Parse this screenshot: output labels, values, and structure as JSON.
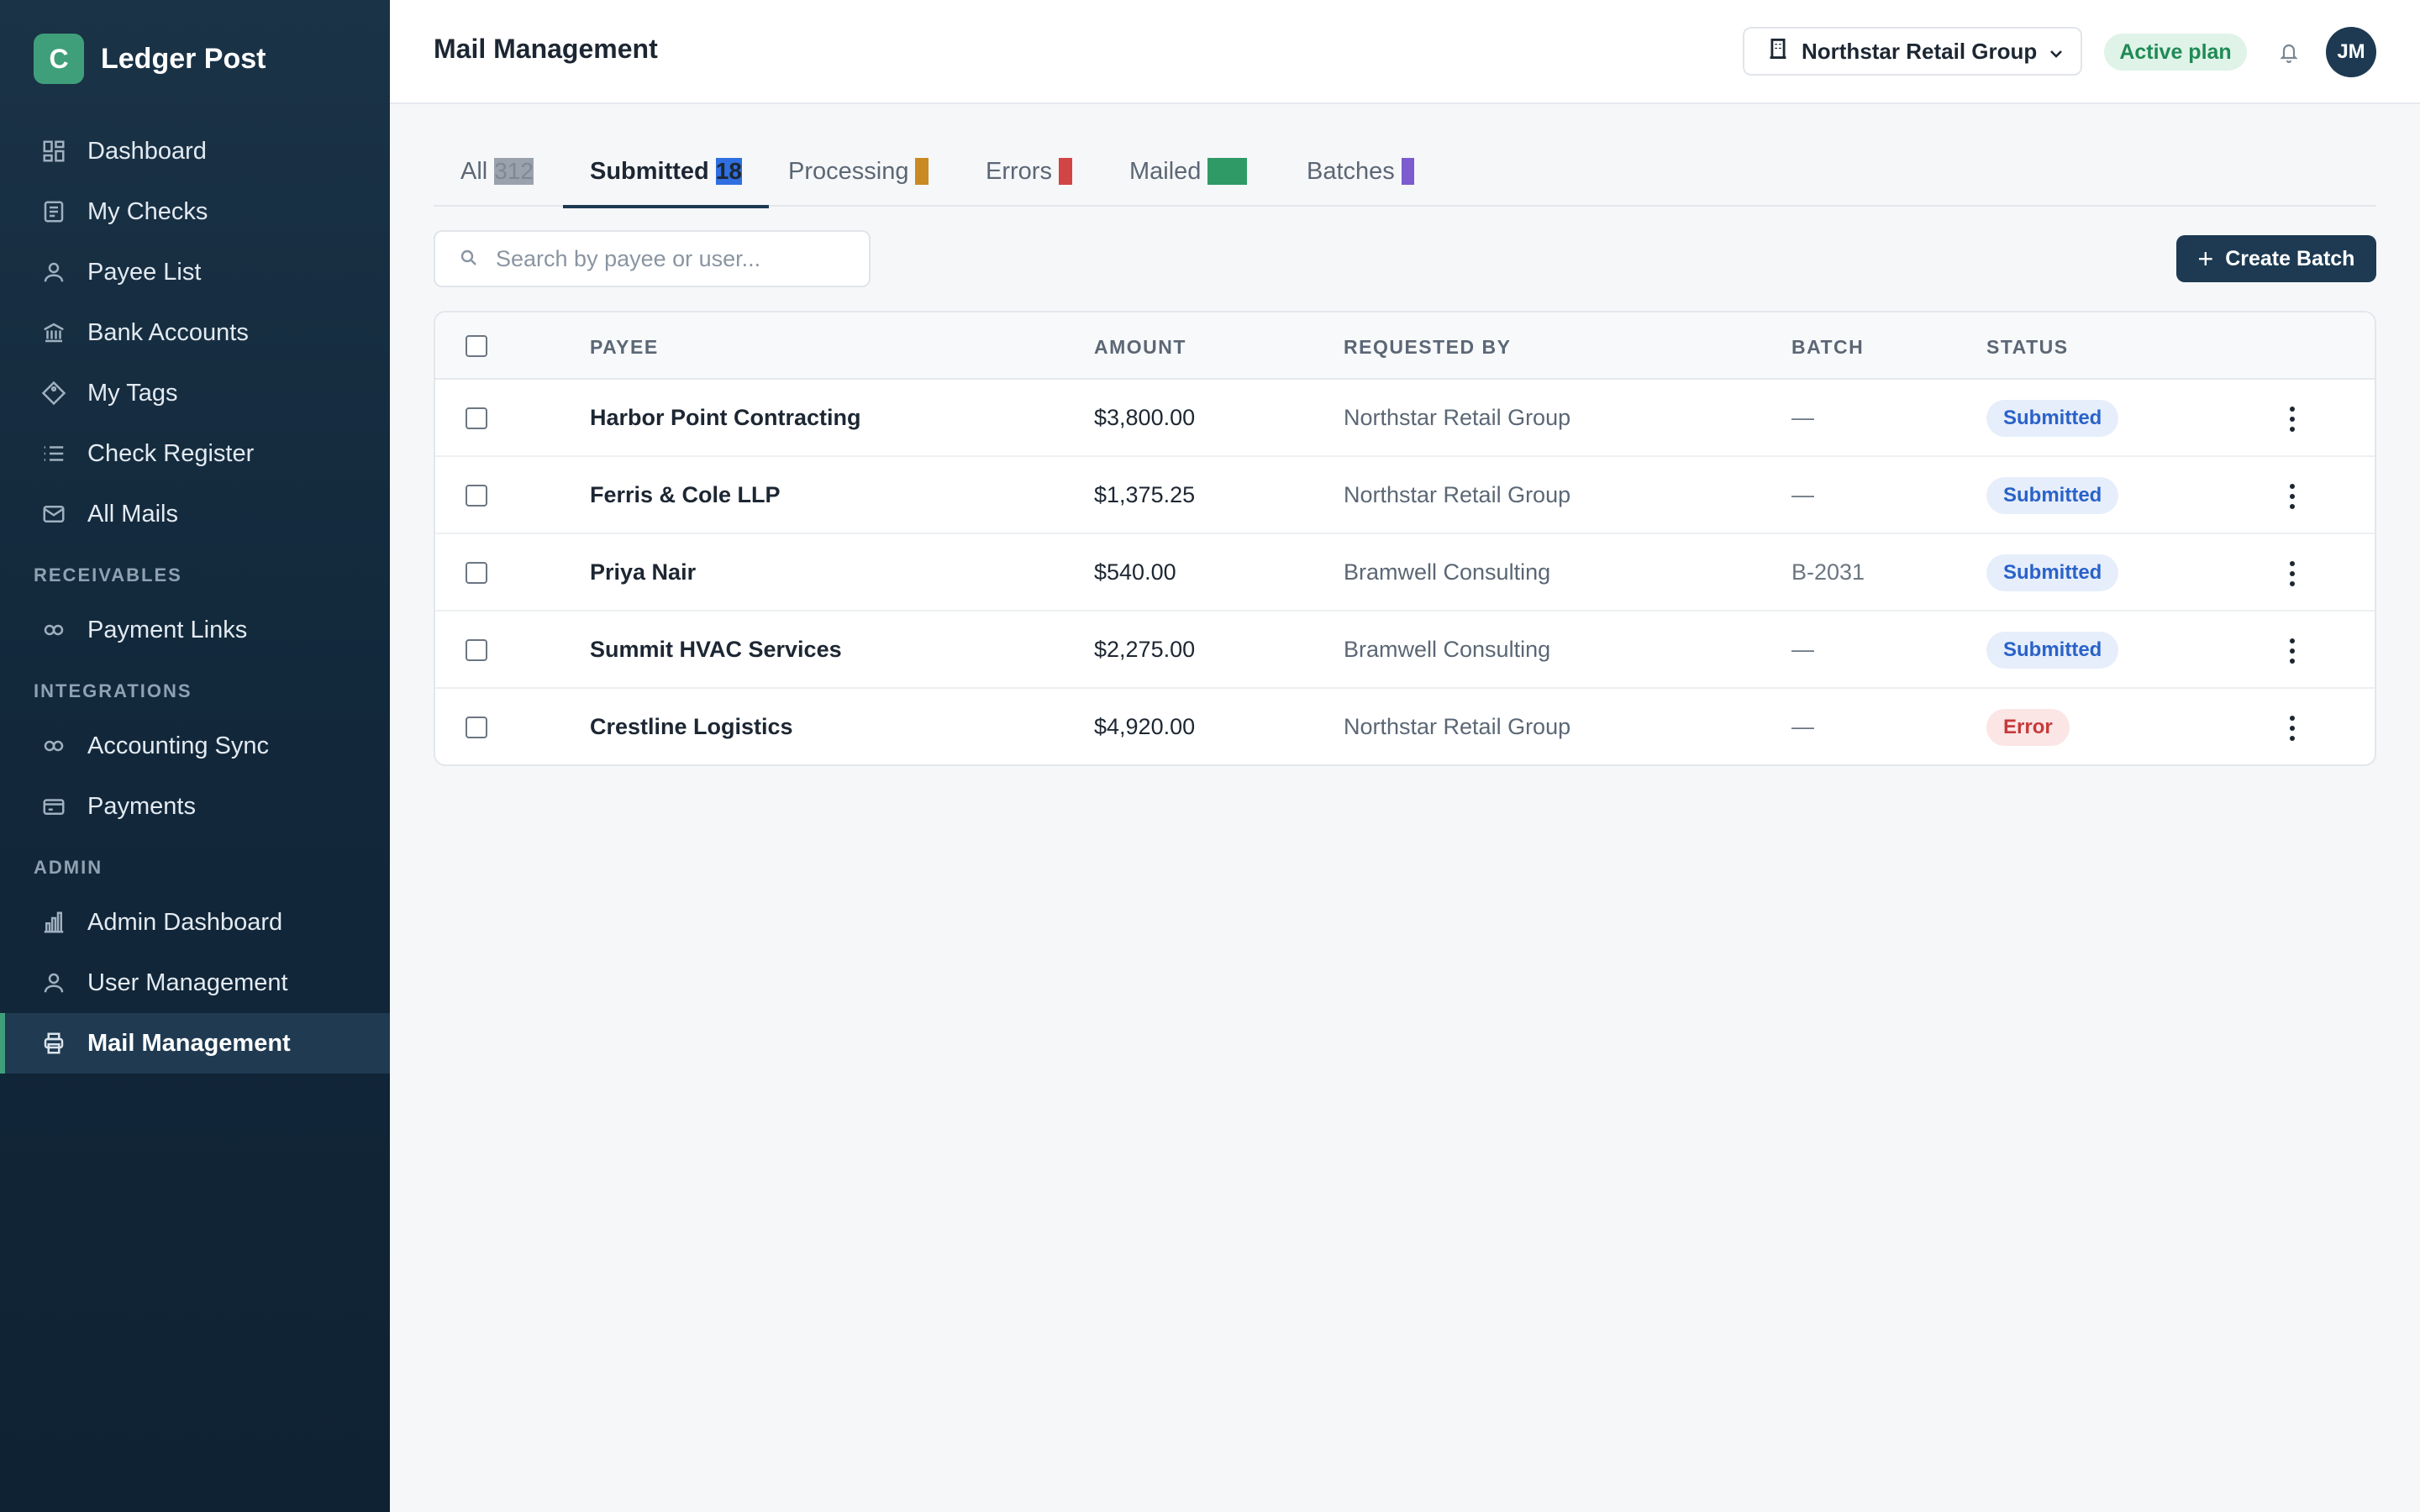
{
  "app": {
    "logo_letter": "C",
    "name": "Ledger Post"
  },
  "sidebar": {
    "items": [
      {
        "label": "Dashboard",
        "icon": "dashboard-icon"
      },
      {
        "label": "My Checks",
        "icon": "checks-icon"
      },
      {
        "label": "Payee List",
        "icon": "user-icon"
      },
      {
        "label": "Bank Accounts",
        "icon": "bank-icon"
      },
      {
        "label": "My Tags",
        "icon": "tag-icon"
      },
      {
        "label": "Check Register",
        "icon": "list-icon"
      },
      {
        "label": "All Mails",
        "icon": "mail-icon"
      }
    ],
    "sections": {
      "receivables": {
        "title": "RECEIVABLES",
        "items": [
          {
            "label": "Payment Links",
            "icon": "link-icon"
          }
        ]
      },
      "integrations": {
        "title": "INTEGRATIONS",
        "items": [
          {
            "label": "Accounting Sync",
            "icon": "link-icon"
          },
          {
            "label": "Payments",
            "icon": "card-icon"
          }
        ]
      },
      "admin": {
        "title": "ADMIN",
        "items": [
          {
            "label": "Admin Dashboard",
            "icon": "bar-chart-icon"
          },
          {
            "label": "User Management",
            "icon": "user-icon"
          },
          {
            "label": "Mail Management",
            "icon": "printer-icon",
            "active": true
          }
        ]
      }
    }
  },
  "header": {
    "title": "Mail Management",
    "org_selector": "Northstar Retail Group",
    "plan_badge": "Active plan",
    "avatar_initials": "JM"
  },
  "tabs": [
    {
      "label": "All",
      "count": "312",
      "count_bg": "#9aa3ad",
      "count_color": "#7f8893"
    },
    {
      "label": "Submitted",
      "count": "18",
      "count_bg": "#2f6fe0",
      "count_color": "#1d2733",
      "active": true
    },
    {
      "label": "Processing",
      "count": "4",
      "count_bg": "#c98a23",
      "count_color": "#c98a23"
    },
    {
      "label": "Errors",
      "count": "2",
      "count_bg": "#d24545",
      "count_color": "#d24545"
    },
    {
      "label": "Mailed",
      "count": "278",
      "count_bg": "#2f9a66",
      "count_color": "#2f9a66"
    },
    {
      "label": "Batches",
      "count": "9",
      "count_bg": "#7c5ccf",
      "count_color": "#7c5ccf"
    }
  ],
  "search": {
    "placeholder": "Search by payee or user..."
  },
  "toolbar": {
    "create_batch_label": "Create Batch"
  },
  "table": {
    "columns": {
      "payee": "PAYEE",
      "amount": "AMOUNT",
      "requested_by": "REQUESTED BY",
      "batch": "BATCH",
      "status": "STATUS"
    },
    "rows": [
      {
        "payee": "Harbor Point Contracting",
        "amount": "$3,800.00",
        "requested_by": "Northstar Retail Group",
        "batch": "—",
        "status": "Submitted",
        "status_type": "submitted"
      },
      {
        "payee": "Ferris & Cole LLP",
        "amount": "$1,375.25",
        "requested_by": "Northstar Retail Group",
        "batch": "—",
        "status": "Submitted",
        "status_type": "submitted"
      },
      {
        "payee": "Priya Nair",
        "amount": "$540.00",
        "requested_by": "Bramwell Consulting",
        "batch": "B-2031",
        "status": "Submitted",
        "status_type": "submitted"
      },
      {
        "payee": "Summit HVAC Services",
        "amount": "$2,275.00",
        "requested_by": "Bramwell Consulting",
        "batch": "—",
        "status": "Submitted",
        "status_type": "submitted"
      },
      {
        "payee": "Crestline Logistics",
        "amount": "$4,920.00",
        "requested_by": "Northstar Retail Group",
        "batch": "—",
        "status": "Error",
        "status_type": "error"
      }
    ]
  }
}
